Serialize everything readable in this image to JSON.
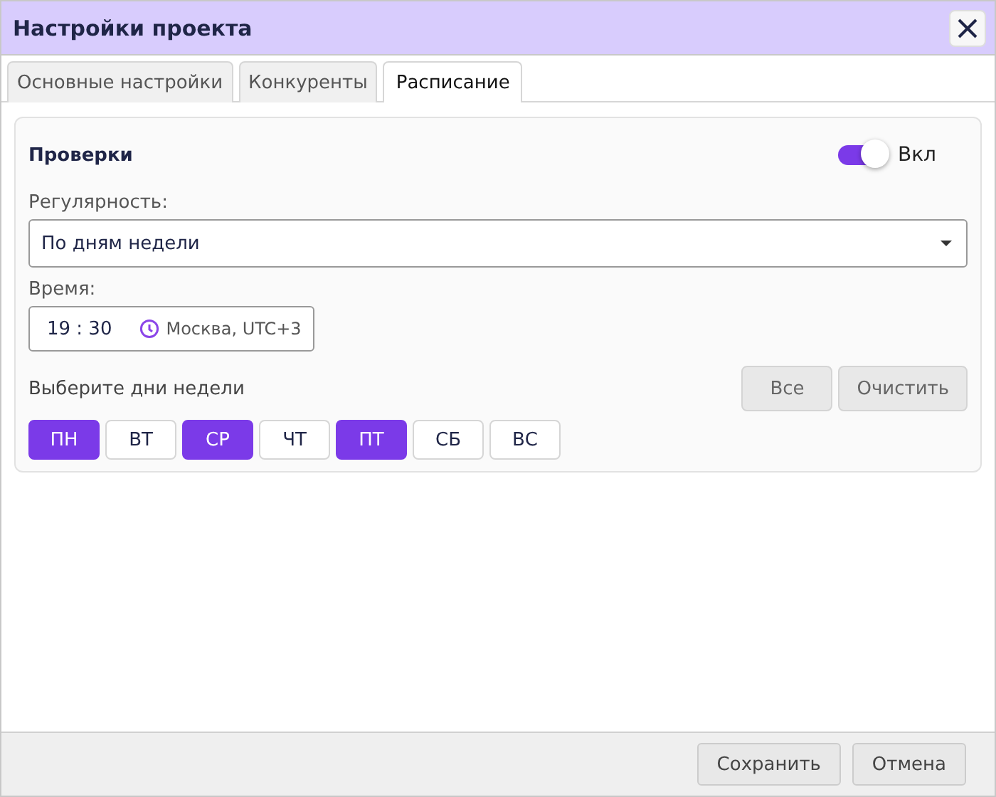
{
  "window": {
    "title": "Настройки проекта"
  },
  "tabs": [
    {
      "label": "Основные настройки",
      "selected": false
    },
    {
      "label": "Конкуренты",
      "selected": false
    },
    {
      "label": "Расписание",
      "selected": true
    }
  ],
  "checks": {
    "title": "Проверки",
    "toggle": {
      "on": true,
      "label": "Вкл"
    },
    "regularity": {
      "label": "Регулярность:",
      "value": "По дням недели"
    },
    "time": {
      "label": "Время:",
      "hours": "19",
      "separator": ":",
      "minutes": "30",
      "timezone": "Москва, UTC+3"
    },
    "days_label": "Выберите дни недели",
    "day_actions": [
      "Все",
      "Очистить"
    ],
    "days": [
      {
        "label": "ПН",
        "selected": true
      },
      {
        "label": "ВТ",
        "selected": false
      },
      {
        "label": "СР",
        "selected": true
      },
      {
        "label": "ЧТ",
        "selected": false
      },
      {
        "label": "ПТ",
        "selected": true
      },
      {
        "label": "СБ",
        "selected": false
      },
      {
        "label": "ВС",
        "selected": false
      }
    ]
  },
  "buttons": [
    "Сохранить",
    "Отмена"
  ]
}
